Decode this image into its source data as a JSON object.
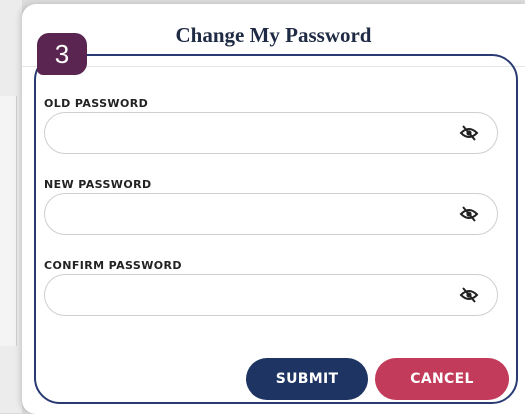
{
  "modal": {
    "title": "Change My Password",
    "step_number": "3"
  },
  "fields": [
    {
      "label": "OLD PASSWORD",
      "value": "",
      "placeholder": ""
    },
    {
      "label": "NEW PASSWORD",
      "value": "",
      "placeholder": ""
    },
    {
      "label": "CONFIRM PASSWORD",
      "value": "",
      "placeholder": ""
    }
  ],
  "icons": {
    "visibility_toggle": "eye-slash-icon"
  },
  "buttons": {
    "submit": "SUBMIT",
    "cancel": "CANCEL"
  },
  "colors": {
    "submit": "#1e3462",
    "cancel": "#c23b5a",
    "step_badge": "#5a2550",
    "step_frame": "#2a3b73"
  }
}
